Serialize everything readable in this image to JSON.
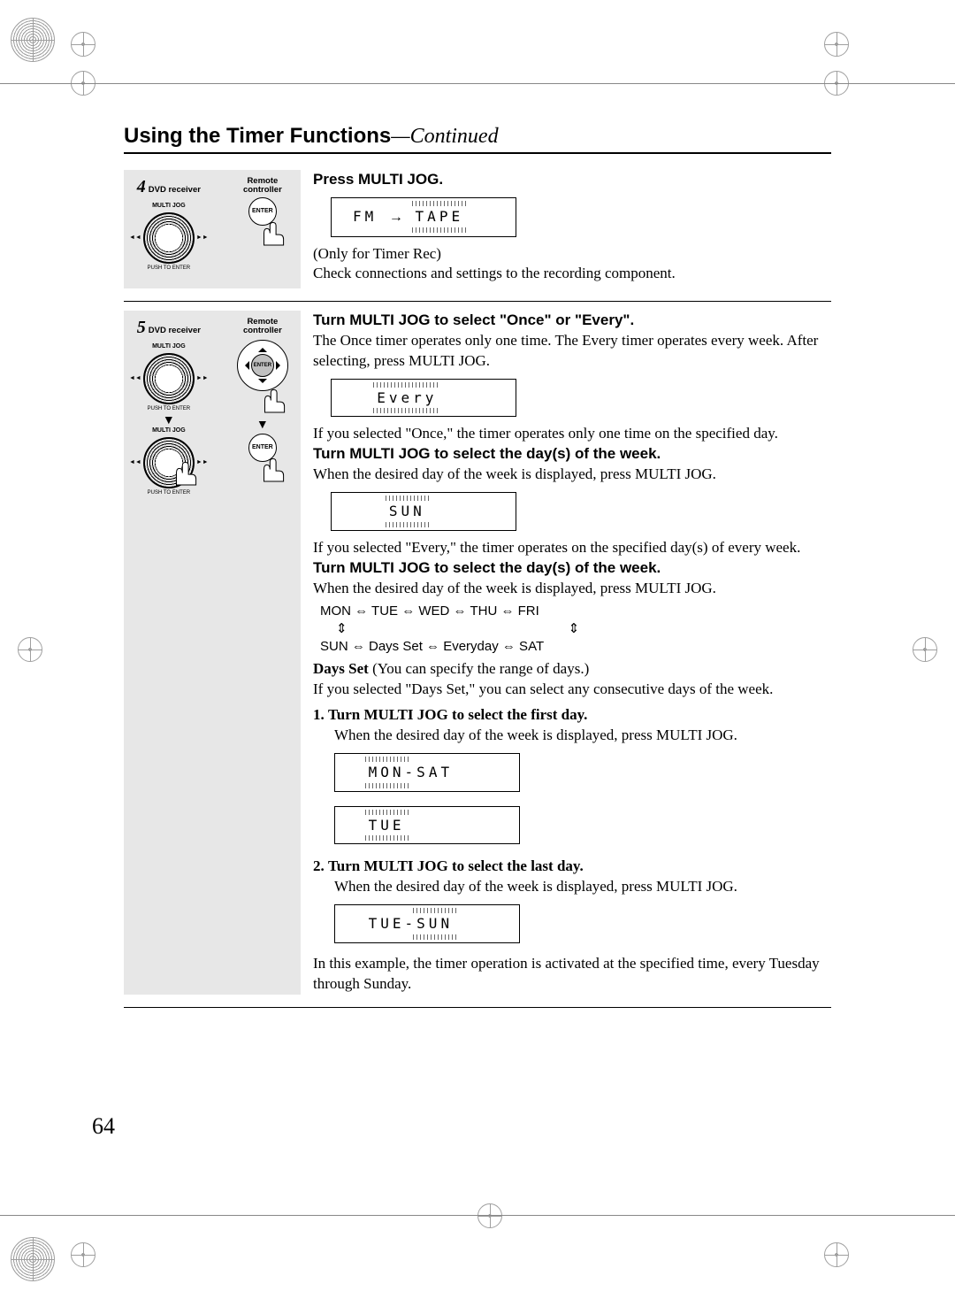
{
  "header": {
    "title_bold": "Using the Timer Functions",
    "title_cont": "—Continued"
  },
  "page_number": "64",
  "labels": {
    "dvd_receiver": "DVD receiver",
    "remote_controller": "Remote controller",
    "multi_jog": "MULTI JOG",
    "push_enter": "PUSH TO ENTER",
    "enter": "ENTER"
  },
  "step4": {
    "num": "4",
    "head": "Press MULTI JOG.",
    "display_left": "FM",
    "display_arrow": "→",
    "display_right": "TAPE",
    "note1": "(Only for Timer Rec)",
    "note2": "Check connections and settings to the recording component."
  },
  "step5": {
    "num": "5",
    "head1": "Turn MULTI JOG to select \"Once\" or \"Every\".",
    "p1": "The Once timer operates only one time. The Every timer operates every week. After selecting, press MULTI JOG.",
    "display1": "Every",
    "p2": "If you selected \"Once,\" the timer operates only one time on the specified day.",
    "head2": "Turn MULTI JOG to select the day(s) of the week.",
    "p3": "When the desired day of the week is displayed, press MULTI JOG.",
    "display2": "SUN",
    "p4": "If you selected \"Every,\" the timer operates on the specified day(s) of every week.",
    "head3": "Turn MULTI JOG to select the day(s) of the week.",
    "p5": "When the desired day of the week is displayed, press MULTI JOG.",
    "cycle_row1": "MON  ⇔  TUE  ⇔  WED  ⇔  THU   ⇔  FRI",
    "cycle_row2a": "⇕",
    "cycle_row2b": "⇕",
    "cycle_row3": "SUN   ⇔  Days Set  ⇔  Everyday   ⇔   SAT",
    "days_set_bold": "Days Set",
    "days_set_rest": " (You can specify the range of days.)",
    "p6": "If you selected \"Days Set,\" you can select any consecutive days of the week.",
    "sub1_num": "1.",
    "sub1_h": "Turn MULTI JOG to select the first day.",
    "sub1_p": "When the desired day of the week is displayed, press MULTI JOG.",
    "display3": "MON-SAT",
    "display3_blink": "MON",
    "display3_plain": "-SAT",
    "display4": "TUE",
    "sub2_num": "2.",
    "sub2_h": "Turn MULTI JOG to select the last day.",
    "sub2_p": "When the desired day of the week is displayed, press MULTI JOG.",
    "display5_plain": "TUE-",
    "display5_blink": "SUN",
    "p7": "In this example, the timer operation is activated at the specified time, every Tuesday through Sunday."
  }
}
